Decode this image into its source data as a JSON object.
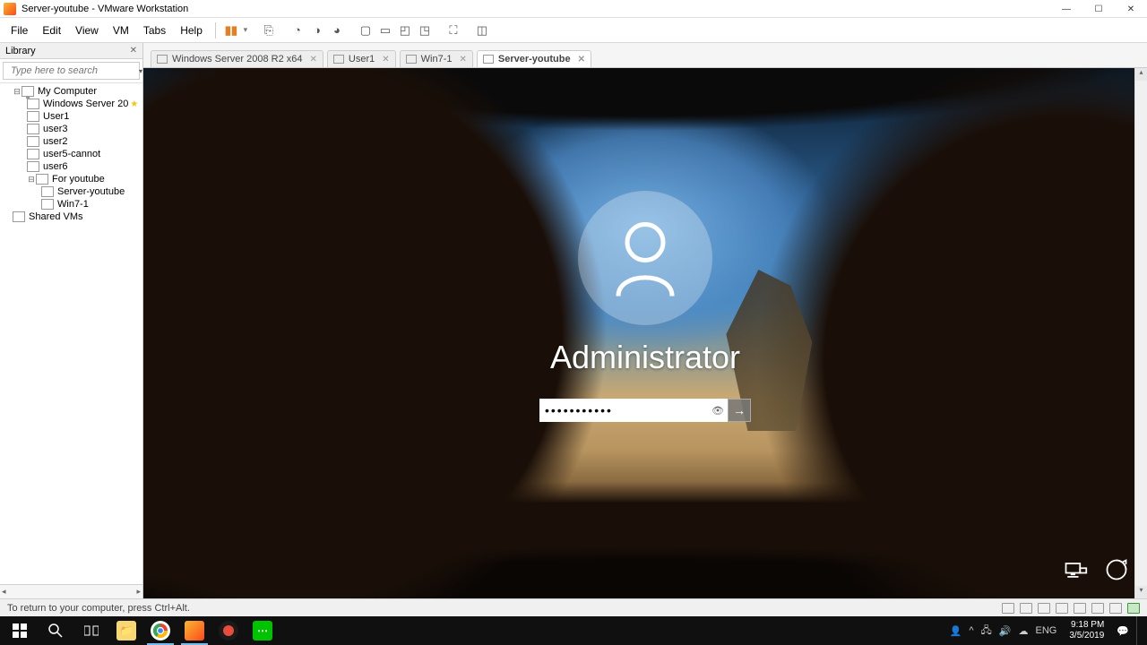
{
  "titlebar": {
    "text": "Server-youtube - VMware Workstation"
  },
  "menu": {
    "items": [
      "File",
      "Edit",
      "View",
      "VM",
      "Tabs",
      "Help"
    ]
  },
  "sidebar": {
    "title": "Library",
    "search_placeholder": "Type here to search",
    "tree": {
      "root": "My Computer",
      "vms": [
        "Windows Server 20",
        "User1",
        "user3",
        "user2",
        "user5-cannot",
        "user6"
      ],
      "folder": "For youtube",
      "folder_vms": [
        "Server-youtube",
        "Win7-1"
      ],
      "shared": "Shared VMs"
    }
  },
  "tabs": [
    {
      "label": "Windows Server 2008 R2 x64",
      "active": false
    },
    {
      "label": "User1",
      "active": false
    },
    {
      "label": "Win7-1",
      "active": false
    },
    {
      "label": "Server-youtube",
      "active": true
    }
  ],
  "login": {
    "username": "Administrator",
    "password_masked": "•••••••••••"
  },
  "statusbar": {
    "hint": "To return to your computer, press Ctrl+Alt."
  },
  "host_taskbar": {
    "lang": "ENG",
    "time": "9:18 PM",
    "date": "3/5/2019"
  }
}
